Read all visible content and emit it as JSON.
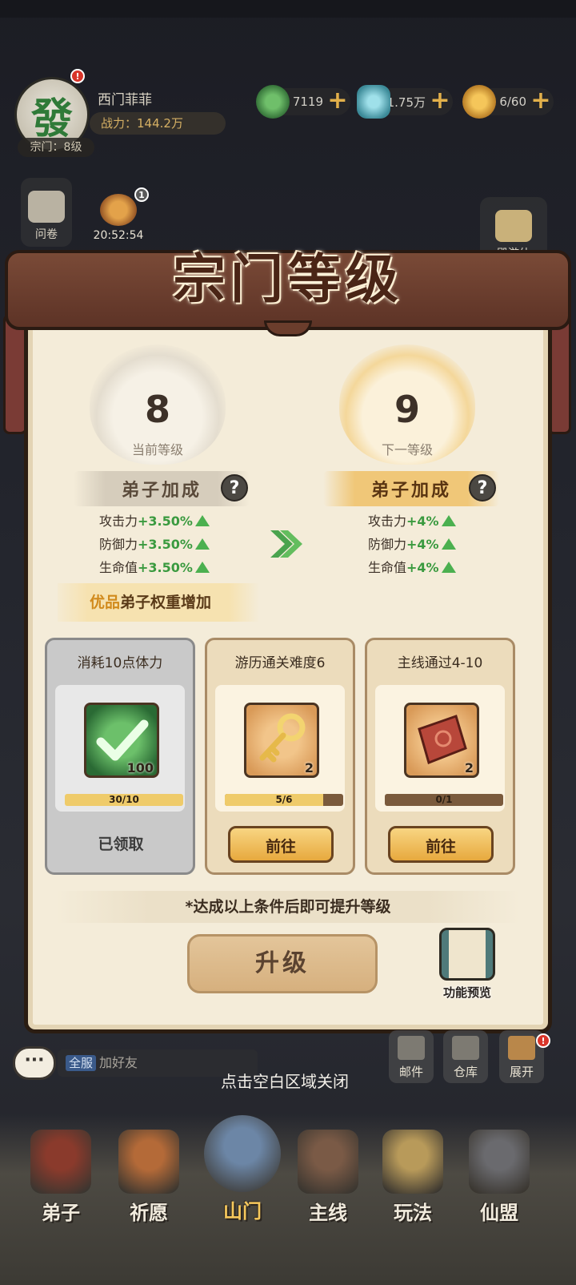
{
  "player": {
    "avatar_glyph": "發",
    "name": "西门菲菲",
    "power": "战力：144.2万",
    "sect_level": "宗门：8级",
    "notice_badge": "!"
  },
  "resources": [
    {
      "icon": "jade-coin-icon",
      "value": "7119",
      "color": "#3f7a44"
    },
    {
      "icon": "spirit-stone-icon",
      "value": "1.75万",
      "color": "#5aa3b0"
    },
    {
      "icon": "money-bag-icon",
      "value": "6/60",
      "color": "#d59a2e"
    }
  ],
  "side": {
    "questionnaire": "问卷",
    "timer": "20:52:54",
    "timer_badge": "1",
    "travel": "殿游仙"
  },
  "modal": {
    "title": "宗门等级",
    "current": {
      "level": "8",
      "label": "当前等级"
    },
    "next": {
      "level": "9",
      "label": "下一等级"
    },
    "bonus_title": "弟子加成",
    "help_glyph": "?",
    "current_stats": [
      {
        "name": "攻击力",
        "value": "+3.50%"
      },
      {
        "name": "防御力",
        "value": "+3.50%"
      },
      {
        "name": "生命值",
        "value": "+3.50%"
      }
    ],
    "next_stats": [
      {
        "name": "攻击力",
        "value": "+4%"
      },
      {
        "name": "防御力",
        "value": "+4%"
      },
      {
        "name": "生命值",
        "value": "+4%"
      }
    ],
    "quality_prefix": "优品",
    "quality_suffix": "弟子权重增加",
    "tasks": [
      {
        "title": "消耗10点体力",
        "item_icon": "check-orb-icon",
        "count": "100",
        "progress_text": "30/10",
        "progress": 1.0,
        "button": "已领取",
        "state": "claimed"
      },
      {
        "title": "游历通关难度6",
        "item_icon": "golden-key-icon",
        "count": "2",
        "progress_text": "5/6",
        "progress": 0.83,
        "button": "前往",
        "state": "go"
      },
      {
        "title": "主线通过4-10",
        "item_icon": "red-scroll-icon",
        "count": "2",
        "progress_text": "0/1",
        "progress": 0.0,
        "button": "前往",
        "state": "go"
      }
    ],
    "note": "*达成以上条件后即可提升等级",
    "upgrade": "升级",
    "preview": "功能预览"
  },
  "bottom": {
    "chat_icon": "···",
    "chat_tag": "全服",
    "chat_text": "加好友",
    "close_hint": "点击空白区域关闭",
    "mail": "邮件",
    "warehouse": "仓库",
    "expand": "展开"
  },
  "nav": [
    {
      "label": "弟子",
      "color": "#8a3a2c"
    },
    {
      "label": "祈愿",
      "color": "#b46a38"
    },
    {
      "label": "山门",
      "color": "#6c86a6",
      "active": true
    },
    {
      "label": "主线",
      "color": "#7a5a46"
    },
    {
      "label": "玩法",
      "color": "#b89a5a"
    },
    {
      "label": "仙盟",
      "color": "#6a6a6e"
    }
  ]
}
